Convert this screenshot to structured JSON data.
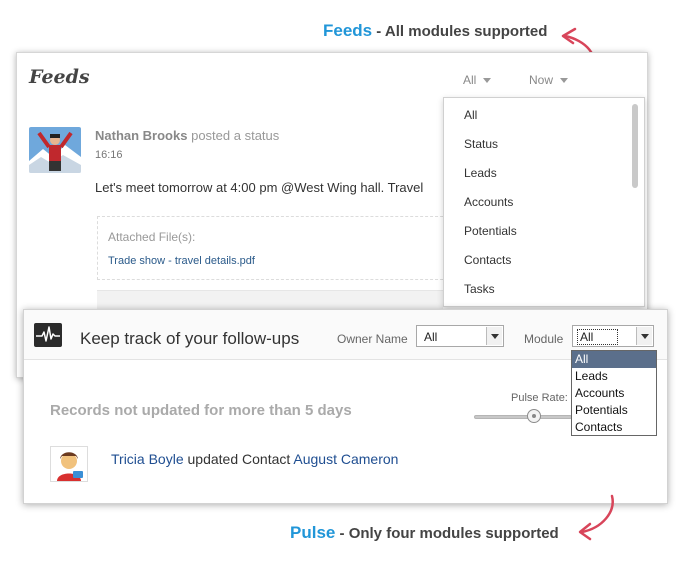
{
  "captions": {
    "feeds_keyword": "Feeds",
    "feeds_text": " - All modules supported",
    "pulse_keyword": "Pulse",
    "pulse_text": " - Only four modules supported"
  },
  "feeds": {
    "title": "Feeds",
    "filter_all": "All",
    "filter_time": "Now",
    "post": {
      "author": "Nathan Brooks",
      "action": "posted a status",
      "time": "16:16",
      "text": "Let's meet tomorrow at 4:00 pm @West Wing hall. Travel",
      "attached_label": "Attached File(s):",
      "attached_file": "Trade show - travel details.pdf"
    },
    "module_options": [
      "All",
      "Status",
      "Leads",
      "Accounts",
      "Potentials",
      "Contacts",
      "Tasks"
    ]
  },
  "pulse": {
    "title": "Keep track of your follow-ups",
    "owner_label": "Owner Name",
    "owner_value": "All",
    "module_label": "Module",
    "module_value": "All",
    "module_options": [
      "All",
      "Leads",
      "Accounts",
      "Potentials",
      "Contacts"
    ],
    "selected_option": "All",
    "records_title": "Records not updated for more than 5 days",
    "pulse_rate_label": "Pulse Rate:",
    "activity": {
      "user": "Tricia Boyle",
      "verb": "updated Contact",
      "record": "August Cameron"
    }
  },
  "colors": {
    "caption_keyword": "#2196d8",
    "link": "#1f4e91",
    "arrow": "#d8455a",
    "selected_option_bg": "#5b6f8b"
  },
  "icons": [
    "curved-arrow-icon",
    "pulse-heartbeat-icon",
    "caret-down-icon"
  ]
}
